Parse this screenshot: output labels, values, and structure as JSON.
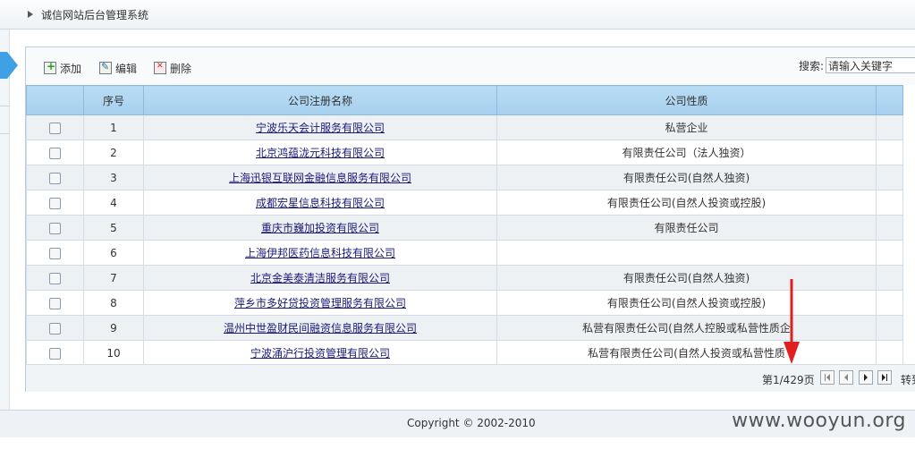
{
  "header": {
    "title": "诚信网站后台管理系统"
  },
  "toolbar": {
    "add_label": "添加",
    "edit_label": "编辑",
    "delete_label": "删除",
    "search_label": "搜索:",
    "search_value": "请输入关键字"
  },
  "table": {
    "columns": [
      "序号",
      "公司注册名称",
      "公司性质"
    ],
    "rows": [
      {
        "no": "1",
        "name": "宁波乐天会计服务有限公司",
        "type": "私营企业"
      },
      {
        "no": "2",
        "name": "北京鸿蕴泷元科技有限公司",
        "type": "有限责任公司（法人独资）"
      },
      {
        "no": "3",
        "name": "上海迅银互联网金融信息服务有限公司",
        "type": "有限责任公司(自然人独资)"
      },
      {
        "no": "4",
        "name": "成都宏星信息科技有限公司",
        "type": "有限责任公司(自然人投资或控股)"
      },
      {
        "no": "5",
        "name": "重庆市巍加投资有限公司",
        "type": "有限责任公司"
      },
      {
        "no": "6",
        "name": "上海伊邦医药信息科技有限公司",
        "type": ""
      },
      {
        "no": "7",
        "name": "北京金美泰清洁服务有限公司",
        "type": "有限责任公司(自然人独资)"
      },
      {
        "no": "8",
        "name": "萍乡市多好贷投资管理服务有限公司",
        "type": "有限责任公司(自然人投资或控股)"
      },
      {
        "no": "9",
        "name": "温州中世盈财民间融资信息服务有限公司",
        "type": "私营有限责任公司(自然人控股或私营性质企"
      },
      {
        "no": "10",
        "name": "宁波涌沪行投资管理有限公司",
        "type": "私营有限责任公司(自然人投资或私营性质"
      }
    ]
  },
  "pager": {
    "info": "第1/429页",
    "goto": "转到"
  },
  "footer": {
    "copyright": "Copyright © 2002-2010"
  },
  "watermark": "www.wooyun.org",
  "colors": {
    "header_bg": "#a6d0ef",
    "arrow": "#e02020",
    "tab": "#3fa0e6"
  }
}
